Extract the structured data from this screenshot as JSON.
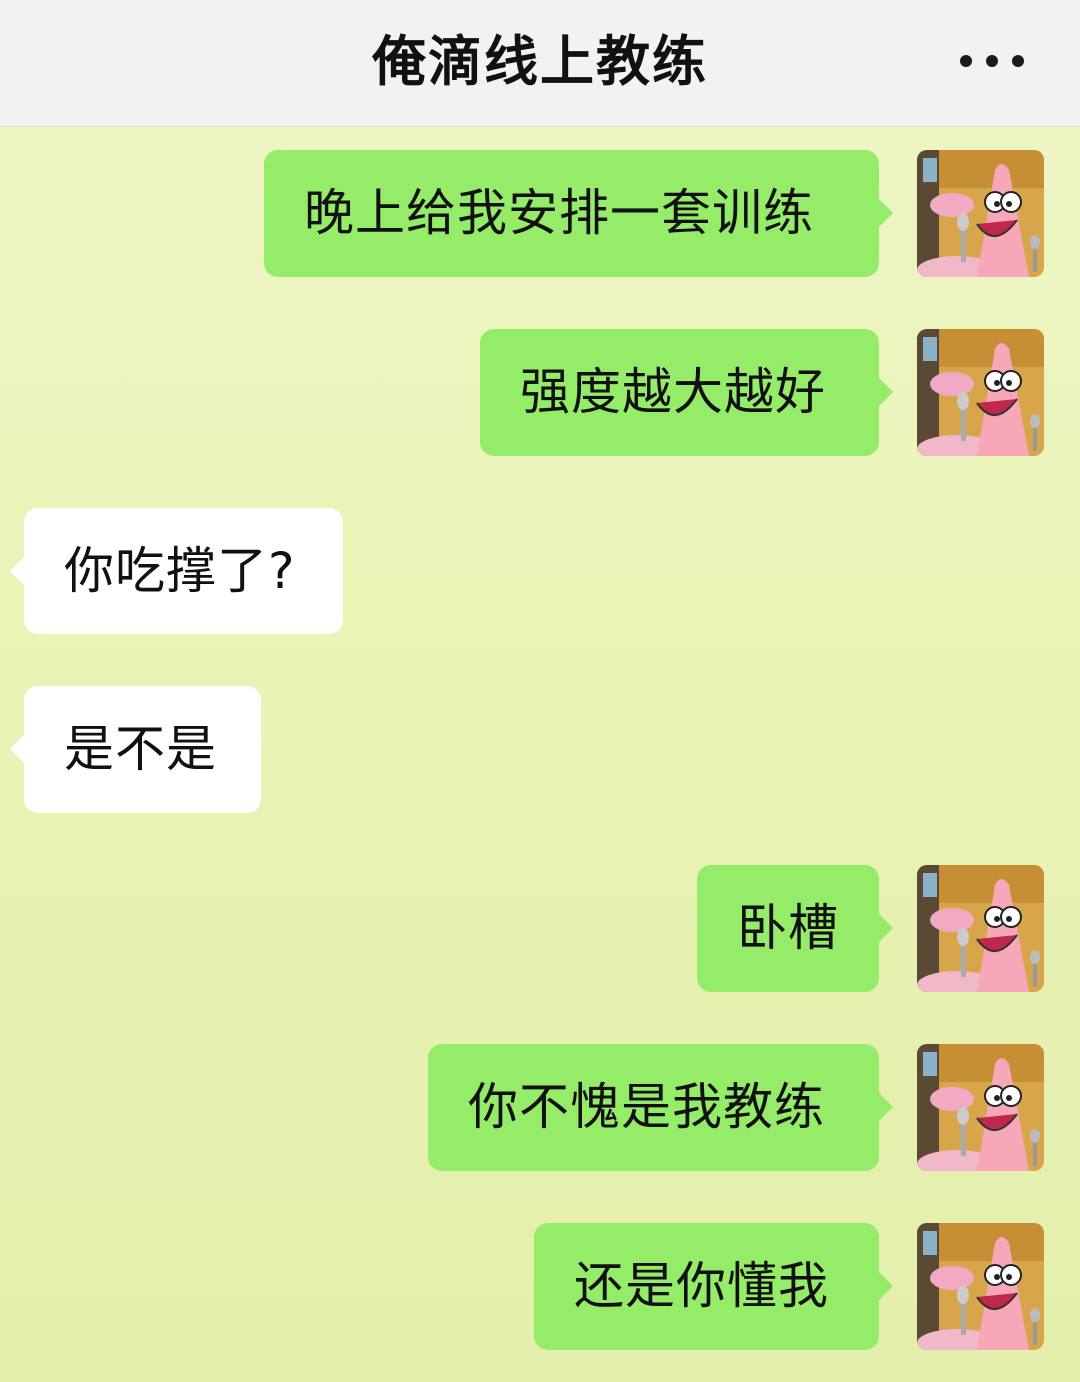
{
  "header": {
    "title": "俺滴线上教练"
  },
  "messages": [
    {
      "from": "me",
      "text": "晚上给我安排一套训练"
    },
    {
      "from": "me",
      "text": "强度越大越好"
    },
    {
      "from": "them",
      "text": "你吃撑了?"
    },
    {
      "from": "them",
      "text": "是不是"
    },
    {
      "from": "me",
      "text": "卧槽"
    },
    {
      "from": "me",
      "text": "你不愧是我教练"
    },
    {
      "from": "me",
      "text": "还是你懂我"
    }
  ],
  "colors": {
    "my_bubble": "#95ec69",
    "their_bubble": "#ffffff",
    "background": "#eaf4b8"
  },
  "icons": {
    "more": "more-dots-icon",
    "avatar": "cartoon-starfish-avatar"
  }
}
